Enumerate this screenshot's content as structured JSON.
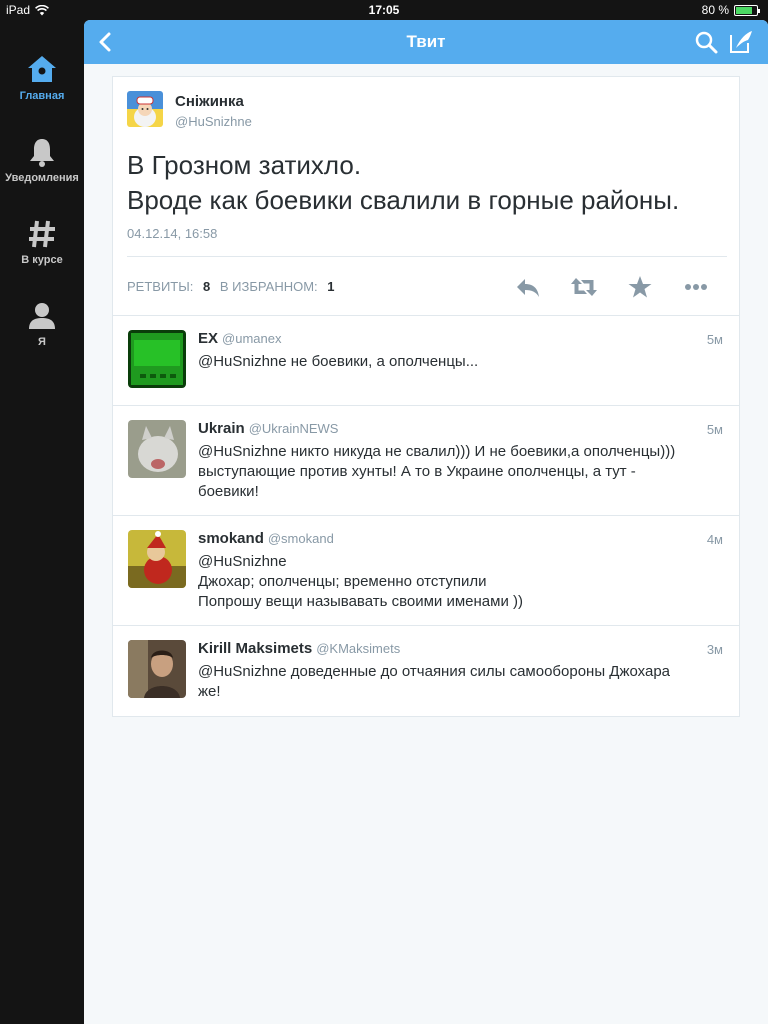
{
  "status_bar": {
    "carrier": "iPad",
    "time": "17:05",
    "battery": "80 %",
    "battery_level": 0.8
  },
  "sidebar": {
    "items": [
      {
        "label": "Главная",
        "icon": "home-icon",
        "active": true
      },
      {
        "label": "Уведомления",
        "icon": "bell-icon",
        "active": false
      },
      {
        "label": "В курсе",
        "icon": "hashtag-icon",
        "active": false
      },
      {
        "label": "Я",
        "icon": "person-icon",
        "active": false
      }
    ]
  },
  "navbar": {
    "title": "Твит"
  },
  "tweet": {
    "name": "Сніжинка",
    "handle": "@HuSnizhne",
    "text": "В Грозном затихло.\nВроде как боевики свалили в горные районы.",
    "date": "04.12.14, 16:58",
    "retweets_label": "РЕТВИТЫ:",
    "retweets": "8",
    "favorites_label": "В ИЗБРАННОМ:",
    "favorites": "1"
  },
  "replies": [
    {
      "name": "EX",
      "handle": "@umanex",
      "time": "5м",
      "text": "@HuSnizhne не боевики, а ополченцы..."
    },
    {
      "name": "Ukrain",
      "handle": "@UkrainNEWS",
      "time": "5м",
      "text": "@HuSnizhne никто никуда не свалил))) И не боевики,а ополченцы)))\nвыступающие против хунты! А то в Украине ополченцы, а тут -\nбоевики!"
    },
    {
      "name": "smokand",
      "handle": "@smokand",
      "time": "4м",
      "text": "@HuSnizhne\nДжохар; ополченцы; временно отступили\nПопрошу вещи называвать своими именами ))"
    },
    {
      "name": "Kirill Maksimets",
      "handle": "@KMaksimets",
      "time": "3м",
      "text": "@HuSnizhne доведенные до отчаяния силы самообороны Джохара\nже!"
    }
  ],
  "colors": {
    "accent": "#55acee",
    "sidebar_bg": "#141414",
    "text": "#292f33",
    "muted": "#8899a6"
  }
}
